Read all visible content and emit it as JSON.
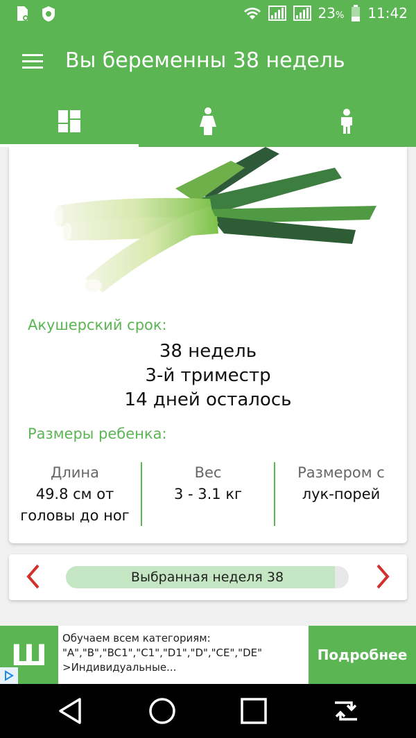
{
  "status_bar": {
    "battery": "23",
    "battery_unit": "%",
    "time": "11:42"
  },
  "app_bar": {
    "title": "Вы беременны 38 недель",
    "tabs": [
      {
        "icon": "dashboard-icon",
        "active": true
      },
      {
        "icon": "mother-icon",
        "active": false
      },
      {
        "icon": "child-icon",
        "active": false
      }
    ]
  },
  "week_info": {
    "obstetric_label": "Акушерский срок:",
    "weeks": "38 недель",
    "trimester": "3-й триместр",
    "days_left": "14 дней осталось",
    "sizes_label": "Размеры ребенка:",
    "sizes": [
      {
        "header": "Длина",
        "value": "49.8 см от головы до ног"
      },
      {
        "header": "Вес",
        "value": "3 - 3.1 кг"
      },
      {
        "header": "Размером с",
        "value": "лук-порей"
      }
    ]
  },
  "week_selector": {
    "label": "Выбранная неделя 38",
    "progress": 0.95,
    "prev_icon": "chevron-left-icon",
    "next_icon": "chevron-right-icon"
  },
  "ad": {
    "logo_letter": "Ш",
    "text": "Обучаем всем категориям: \"A\",\"B\",\"BC1\",\"C1\",\"D1\",\"D\",\"CE\",\"DE\" >Индивидуальные...",
    "button_label": "Подробнее"
  },
  "colors": {
    "primary": "#5bb553",
    "accent_red": "#d32f2f",
    "progress_fill": "#c5e6c3"
  }
}
